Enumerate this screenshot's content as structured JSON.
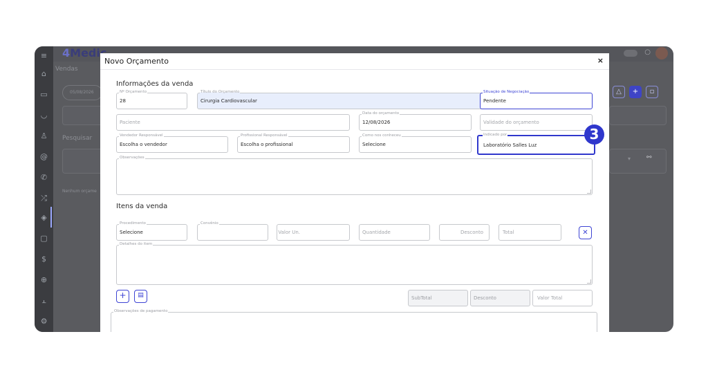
{
  "app": {
    "brand_prefix": "4",
    "brand_name": "Medic",
    "page_title": "Vendas",
    "date_filter": "05/08/2026",
    "search_label": "Pesquisar",
    "empty_message": "Nenhum orçame"
  },
  "modal": {
    "title": "Novo Orçamento",
    "close_label": "×",
    "sale_section_title": "Informações da venda",
    "items_section_title": "Itens da venda",
    "fields": {
      "numero": {
        "label": "Nº Orçamento",
        "value": "28"
      },
      "titulo": {
        "label": "Título do Orçamento",
        "value": "Cirurgia Cardiovascular"
      },
      "situacao": {
        "label": "Situação de Negociação",
        "value": "Pendente"
      },
      "paciente": {
        "placeholder": "Paciente"
      },
      "data": {
        "label": "Data do orçamento",
        "value": "12/08/2026"
      },
      "validade": {
        "placeholder": "Validade do orçamento"
      },
      "vendedor": {
        "label": "Vendedor Responsável",
        "value": "Escolha o vendedor"
      },
      "profissional": {
        "label": "Profissional Responsável",
        "value": "Escolha o profissional"
      },
      "como_conheceu": {
        "label": "Como nos conheceu",
        "value": "Selecione"
      },
      "indicado_por": {
        "label": "Indicado por",
        "value": "Laboratório Salles Luz"
      },
      "observacoes": {
        "label": "Observações"
      }
    },
    "item_fields": {
      "procedimento": {
        "label": "Procedimento",
        "value": "Selecione"
      },
      "convenio": {
        "label": "Convênio"
      },
      "valor_un": {
        "placeholder": "Valor Un."
      },
      "quantidade": {
        "placeholder": "Quantidade"
      },
      "desconto": {
        "placeholder": "Desconto"
      },
      "total": {
        "placeholder": "Total"
      },
      "detalhes": {
        "label": "Detalhes do item"
      }
    },
    "totals": {
      "subtotal": "SubTotal",
      "desconto": "Desconto",
      "valor_total": "Valor Total"
    },
    "payment_notes_label": "Observações de pagamento",
    "step_badge": "3"
  },
  "colors": {
    "accent": "#3c43d4",
    "highlight_field": "#e8eefc",
    "overlay": "#5a5b5f"
  }
}
